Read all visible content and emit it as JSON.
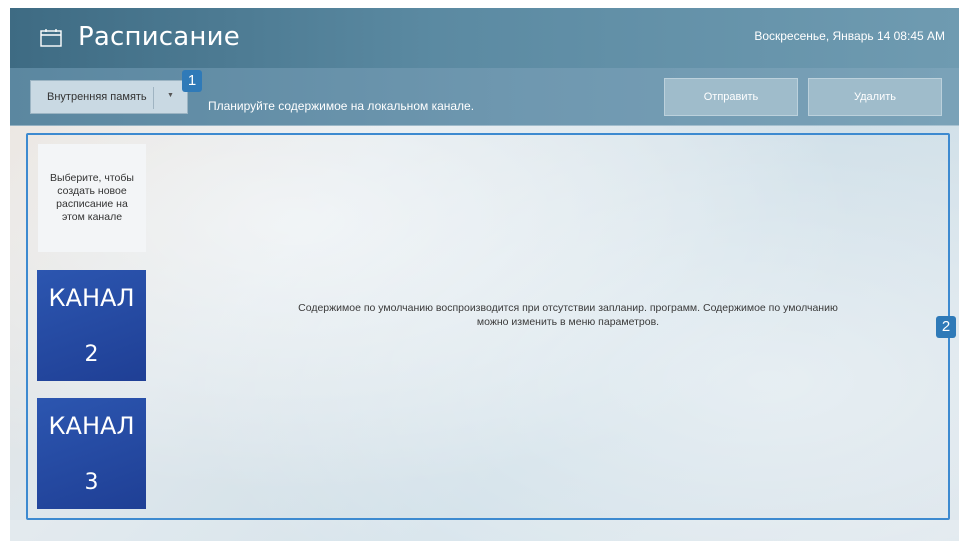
{
  "header": {
    "title": "Расписание",
    "datetime": "Воскресенье, Январь 14 08:45 AM",
    "icon": "calendar-icon"
  },
  "toolbar": {
    "storage": {
      "selected": "Внутренняя память"
    },
    "hint": "Планируйте содержимое на локальном канале.",
    "send_label": "Отправить",
    "delete_label": "Удалить"
  },
  "markers": {
    "one": "1",
    "two": "2"
  },
  "schedule": {
    "new_tile_text": "Выберите, чтобы создать новое расписание на этом канале",
    "channels": [
      {
        "label": "КАНАЛ",
        "number": "2"
      },
      {
        "label": "КАНАЛ",
        "number": "3"
      }
    ],
    "default_message": "Содержимое по умолчанию воспроизводится при отсутствии запланир. программ. Содержимое по умолчанию можно изменить в меню параметров."
  },
  "colors": {
    "accent": "#3d8ad0",
    "channel_tile": "#2346a0",
    "header": "#4f7f98"
  }
}
